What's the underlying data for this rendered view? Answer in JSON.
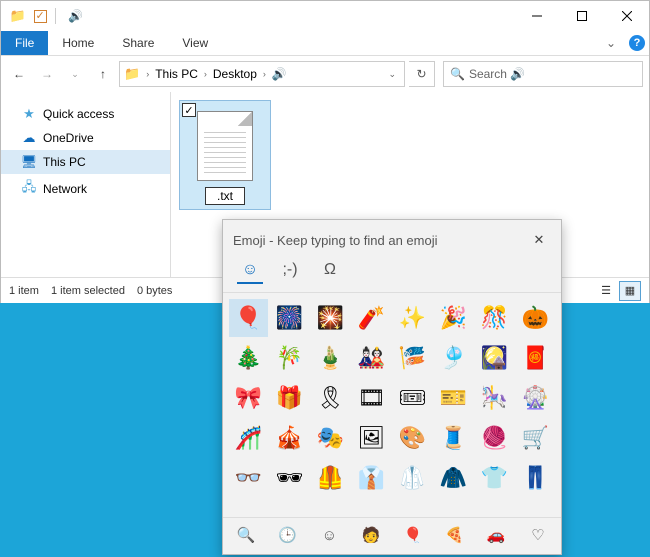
{
  "title_emoji": "🔊",
  "ribbon": {
    "file": "File",
    "home": "Home",
    "share": "Share",
    "view": "View"
  },
  "breadcrumb": {
    "root": "This PC",
    "folder": "Desktop",
    "leaf": "🔊"
  },
  "search": {
    "placeholder": "Search 🔊"
  },
  "sidebar": {
    "quick": "Quick access",
    "onedrive": "OneDrive",
    "thispc": "This PC",
    "network": "Network"
  },
  "file": {
    "name": ".txt"
  },
  "status": {
    "count": "1 item",
    "selected": "1 item selected",
    "size": "0 bytes"
  },
  "emoji": {
    "title": "Emoji - Keep typing to find an emoji",
    "tab_kaomoji": ";-)",
    "tab_symbols": "Ω",
    "cats": [
      "🔍",
      "🕒",
      "☺",
      "🧑",
      "🎈",
      "🍕",
      "🚗",
      "♡"
    ],
    "grid": [
      "🎈",
      "🎆",
      "🎇",
      "🧨",
      "✨",
      "🎉",
      "🎊",
      "🎃",
      "🎄",
      "🎋",
      "🎍",
      "🎎",
      "🎏",
      "🎐",
      "🎑",
      "🧧",
      "🎀",
      "🎁",
      "🎗",
      "🎞",
      "🎟",
      "🎫",
      "🎠",
      "🎡",
      "🎢",
      "🎪",
      "🎭",
      "🖼",
      "🎨",
      "🧵",
      "🧶",
      "🛒",
      "👓",
      "🕶",
      "🦺",
      "👔",
      "🥼",
      "🧥",
      "👕",
      "👖"
    ]
  }
}
